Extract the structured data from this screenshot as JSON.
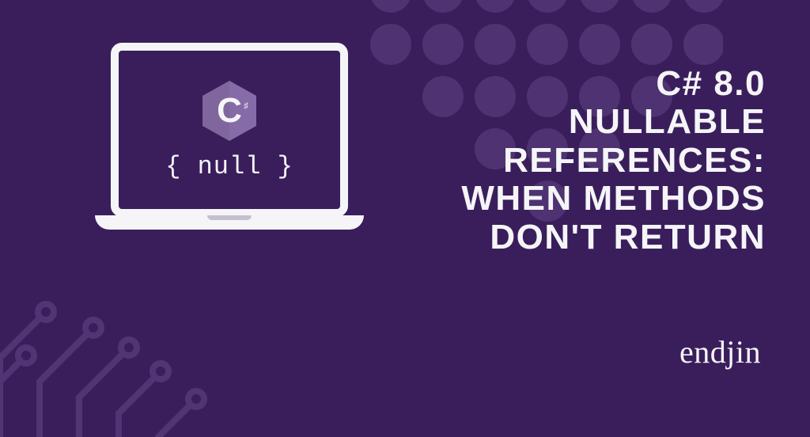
{
  "laptop": {
    "csharp_symbol": "C",
    "null_text": "{ null }"
  },
  "title": {
    "line1": "C# 8.0",
    "line2": "NULLABLE",
    "line3": "REFERENCES:",
    "line4": "WHEN METHODS",
    "line5": "DON'T RETURN"
  },
  "brand": "endjin",
  "colors": {
    "background": "#3a1e5c",
    "accent": "#f5f5f7",
    "pattern": "#6b4a8f"
  }
}
